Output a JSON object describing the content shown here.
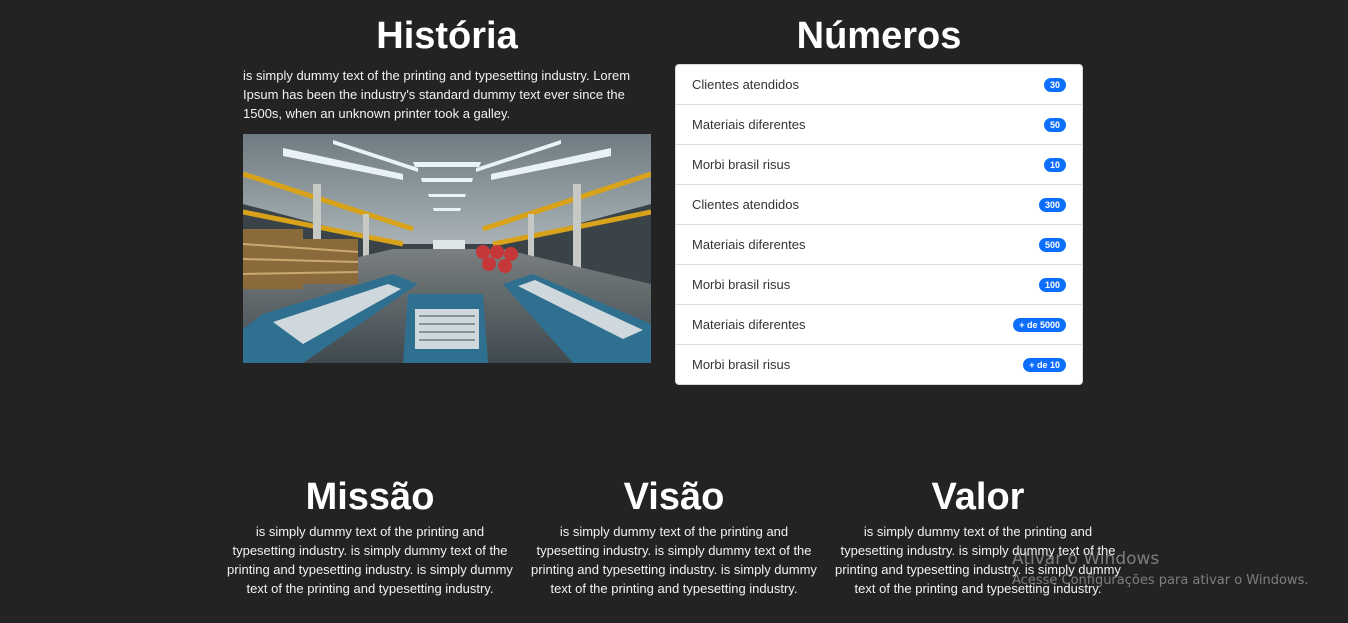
{
  "historia": {
    "title": "História",
    "text": "is simply dummy text of the printing and typesetting industry. Lorem Ipsum has been the industry's standard dummy text ever since the 1500s, when an unknown printer took a galley."
  },
  "numeros": {
    "title": "Números",
    "items": [
      {
        "label": "Clientes atendidos",
        "badge": "30"
      },
      {
        "label": "Materiais diferentes",
        "badge": "50"
      },
      {
        "label": "Morbi brasil risus",
        "badge": "10"
      },
      {
        "label": "Clientes atendidos",
        "badge": "300"
      },
      {
        "label": "Materiais diferentes",
        "badge": "500"
      },
      {
        "label": "Morbi brasil risus",
        "badge": "100"
      },
      {
        "label": "Materiais diferentes",
        "badge": "+ de 5000"
      },
      {
        "label": "Morbi brasil risus",
        "badge": "+ de 10"
      }
    ],
    "badge_color": "#0d6efd"
  },
  "missao": {
    "title": "Missão",
    "text": "is simply dummy text of the printing and typesetting industry. is simply dummy text of the printing and typesetting industry. is simply dummy text of the printing and typesetting industry."
  },
  "visao": {
    "title": "Visão",
    "text": "is simply dummy text of the printing and typesetting industry. is simply dummy text of the printing and typesetting industry. is simply dummy text of the printing and typesetting industry."
  },
  "valor": {
    "title": "Valor",
    "text": "is simply dummy text of the printing and typesetting industry. is simply dummy text of the printing and typesetting industry. is simply dummy text of the printing and typesetting industry."
  },
  "watermark": {
    "title": "Ativar o Windows",
    "subtitle": "Acesse Configurações para ativar o Windows."
  },
  "colors": {
    "background": "#232323",
    "accent": "#0d6efd"
  }
}
